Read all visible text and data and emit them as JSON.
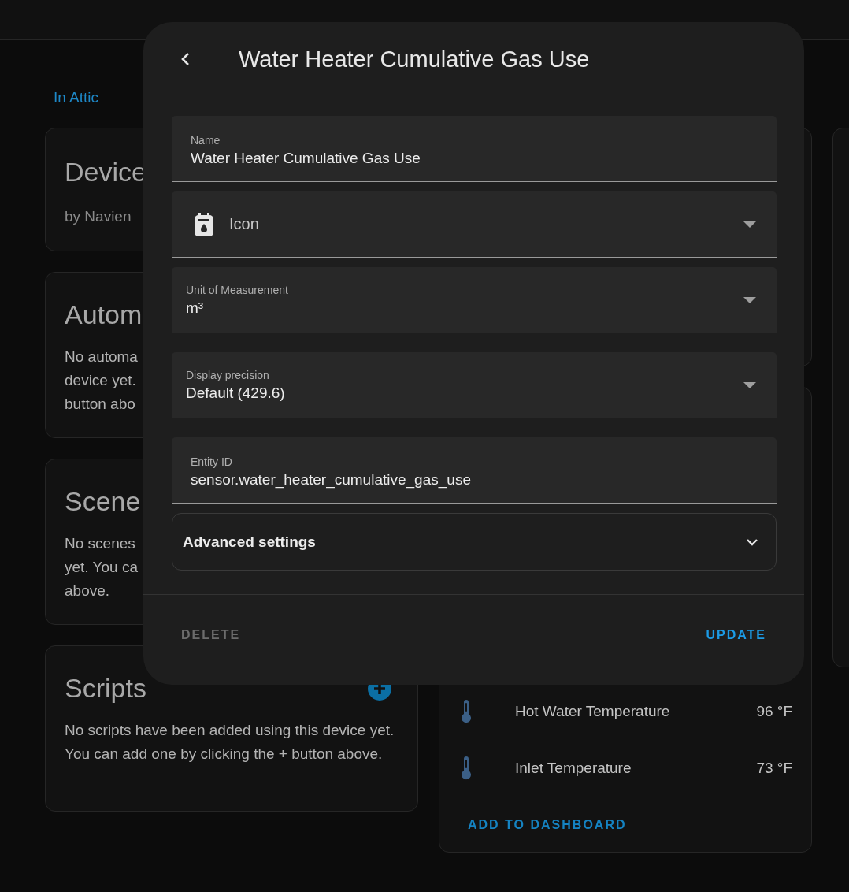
{
  "breadcrumb": "In Attic",
  "left_cards": [
    {
      "kind": "info",
      "title": "Device",
      "lines": [
        "by Navien"
      ]
    },
    {
      "kind": "section",
      "title": "Autom",
      "lines": [
        "No automa",
        "device yet.",
        "button abo"
      ]
    },
    {
      "kind": "section",
      "title": "Scene",
      "lines": [
        "No scenes",
        "yet. You ca",
        "above."
      ]
    }
  ],
  "scripts_card": {
    "title": "Scripts",
    "text": "No scripts have been added using this device yet. You can add one by clicking the + button above."
  },
  "sensors_card": {
    "rows": [
      {
        "name": "Hot Water Temperature",
        "value": "96 °F"
      },
      {
        "name": "Inlet Temperature",
        "value": "73 °F"
      }
    ],
    "action": "ADD TO DASHBOARD"
  },
  "dialog": {
    "title": "Water Heater Cumulative Gas Use",
    "fields": [
      {
        "kind": "text",
        "label": "Name",
        "value": "Water Heater Cumulative Gas Use"
      },
      {
        "kind": "icon",
        "placeholder": "Icon"
      },
      {
        "kind": "select",
        "label": "Unit of Measurement",
        "value": "m³"
      },
      {
        "kind": "select",
        "label": "Display precision",
        "value": "Default (429.6)"
      },
      {
        "kind": "text",
        "label": "Entity ID",
        "value": "sensor.water_heater_cumulative_gas_use"
      }
    ],
    "advanced": {
      "label": "Advanced settings",
      "expanded": false
    },
    "delete": {
      "label": "DELETE",
      "disabled": true
    },
    "update": {
      "label": "UPDATE"
    }
  }
}
